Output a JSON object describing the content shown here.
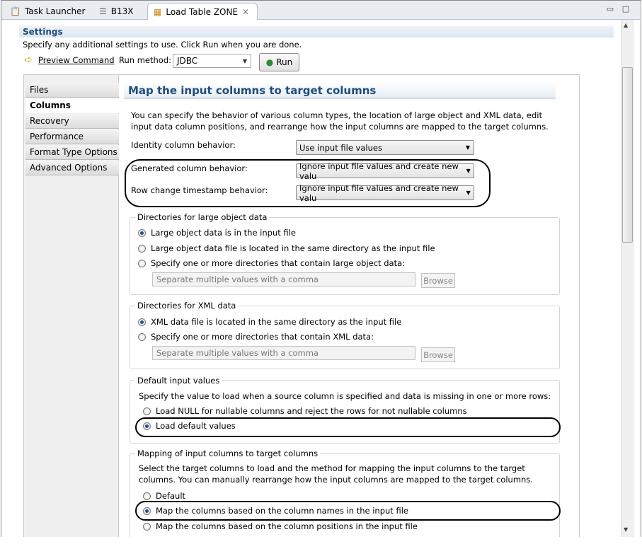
{
  "tabs": [
    {
      "label": "Task Launcher",
      "icon": "clipboard-icon"
    },
    {
      "label": "B13X",
      "icon": "document-icon"
    },
    {
      "label": "Load Table ZONE",
      "icon": "table-icon",
      "active": true
    }
  ],
  "settings": {
    "title": "Settings",
    "description": "Specify any additional settings to use. Click Run when you are done.",
    "preview_command": "Preview Command",
    "run_method_label": "Run method:",
    "run_method_value": "JDBC",
    "run_label": "Run"
  },
  "nav": {
    "items": [
      "Files",
      "Columns",
      "Recovery",
      "Performance",
      "Format Type Options",
      "Advanced Options"
    ],
    "selected": "Columns"
  },
  "main": {
    "heading": "Map the input columns to target columns",
    "description": "You can specify the behavior of various column types, the location of large object and XML data, edit input data column positions, and rearrange how the input columns are mapped to the target columns.",
    "identity_label": "Identity column behavior:",
    "identity_value": "Use input file values",
    "generated_label": "Generated column behavior:",
    "generated_value": "Ignore input file values and create new valu",
    "rowchange_label": "Row change timestamp behavior:",
    "rowchange_value": "Ignore input file values and create new valu",
    "lob": {
      "title": "Directories for large object data",
      "options": [
        "Large object data is in the input file",
        "Large object data file is located in the same directory as the input file",
        "Specify one or more directories that contain large object data:"
      ],
      "selected": 0,
      "placeholder": "Separate multiple values with a comma",
      "browse": "Browse"
    },
    "xml": {
      "title": "Directories for XML data",
      "options": [
        "XML data file is located in the same directory as the input file",
        "Specify one or more directories that contain XML data:"
      ],
      "selected": 0,
      "placeholder": "Separate multiple values with a comma",
      "browse": "Browse"
    },
    "defaults": {
      "title": "Default input values",
      "description": "Specify the value to load when a source column is specified and data is missing in one or more rows:",
      "options": [
        "Load NULL for nullable columns and reject the rows for not nullable columns",
        "Load default values"
      ],
      "selected": 1
    },
    "mapping": {
      "title": "Mapping of input columns to target columns",
      "description": "Select the target columns to load and the method for mapping the input columns to the target columns. You can manually rearrange how the input columns are mapped to the target columns.",
      "options": [
        "Default",
        "Map the columns based on the column names in the input file",
        "Map the columns based on the column positions in the input file"
      ],
      "selected": 1
    }
  }
}
